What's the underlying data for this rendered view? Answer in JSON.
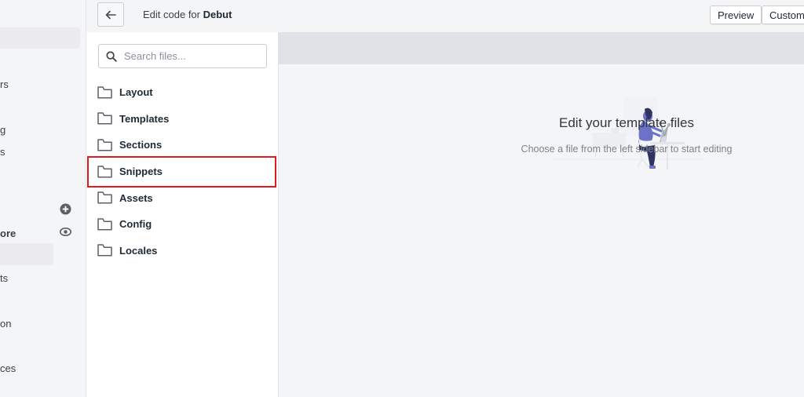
{
  "admin_nav": {
    "fragments": [
      {
        "text": "rs",
        "bold": false
      },
      {
        "text": "g",
        "bold": false
      },
      {
        "text": "s",
        "bold": false
      },
      {
        "text": "ore",
        "bold": true
      },
      {
        "text": "ts",
        "bold": false
      },
      {
        "text": "on",
        "bold": false
      },
      {
        "text": "ces",
        "bold": false
      }
    ],
    "icons": [
      "add-circle-icon",
      "eye-icon"
    ]
  },
  "header": {
    "back_icon": "arrow-left-icon",
    "title_prefix": "Edit code for ",
    "theme_name": "Debut",
    "preview_label": "Preview",
    "customize_label": "Customi"
  },
  "sidebar": {
    "search_placeholder": "Search files...",
    "search_value": "",
    "folders": [
      {
        "label": "Layout"
      },
      {
        "label": "Templates"
      },
      {
        "label": "Sections"
      },
      {
        "label": "Snippets",
        "highlighted": true
      },
      {
        "label": "Assets"
      },
      {
        "label": "Config"
      },
      {
        "label": "Locales"
      }
    ]
  },
  "main": {
    "empty_title": "Edit your template files",
    "empty_subtitle": "Choose a file from the left sidebar to start editing"
  },
  "colors": {
    "highlight_border": "#e0191f",
    "illustration_accent": "#6d71c9"
  }
}
